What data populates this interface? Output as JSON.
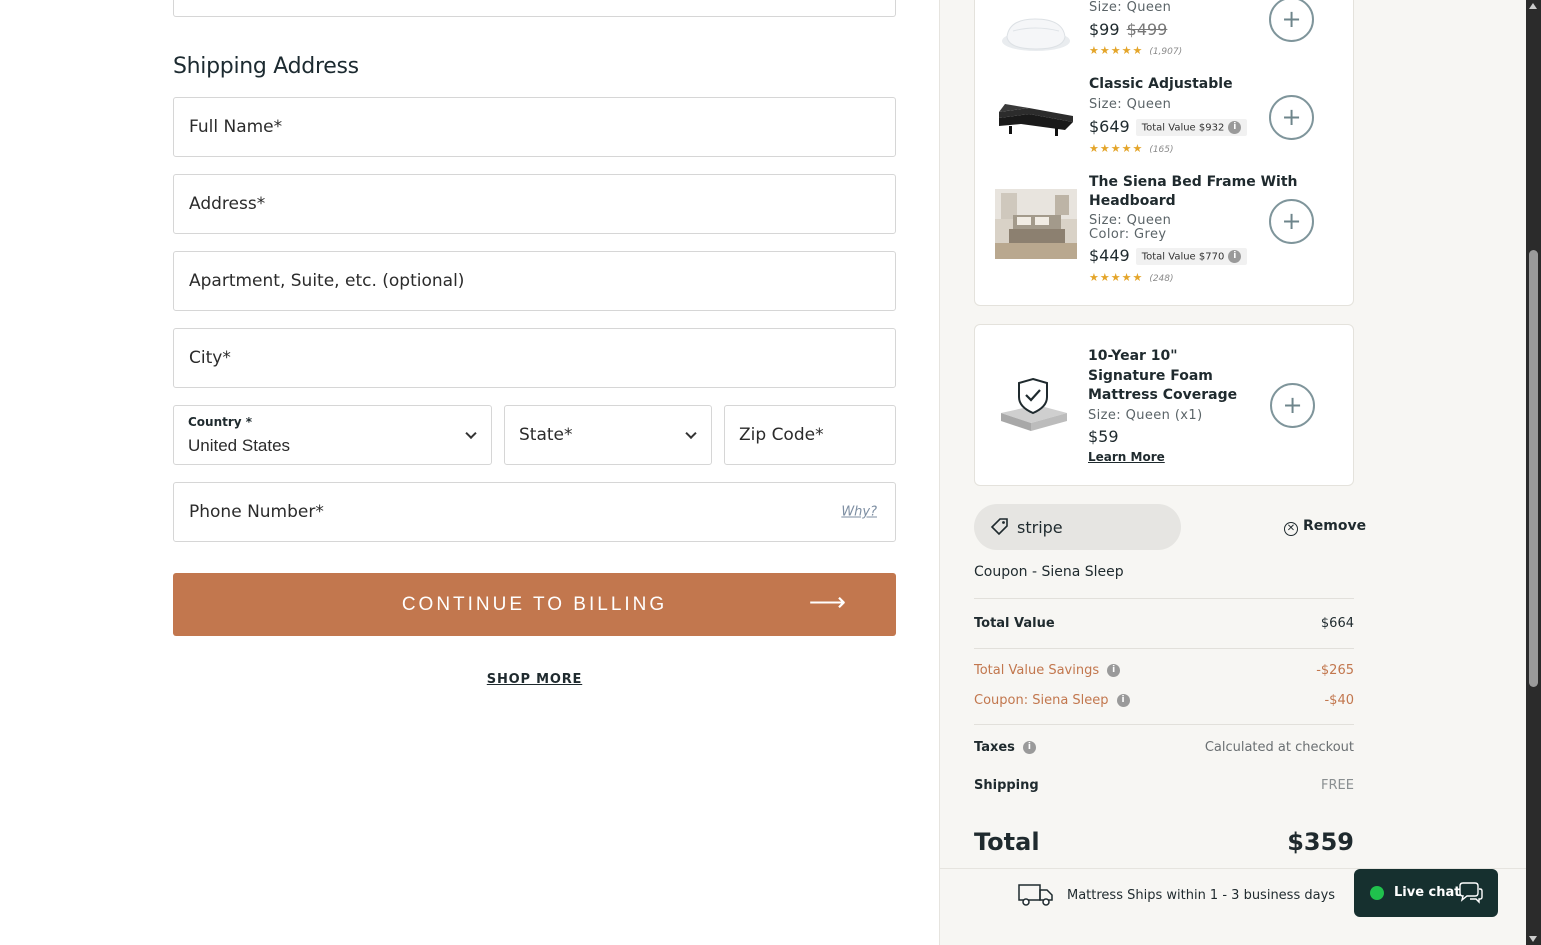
{
  "shipping": {
    "heading": "Shipping Address",
    "full_name_placeholder": "Full Name*",
    "address_placeholder": "Address*",
    "apartment_placeholder": "Apartment, Suite, etc. (optional)",
    "city_placeholder": "City*",
    "country_label": "Country *",
    "country_value": "United States",
    "state_placeholder": "State*",
    "zip_placeholder": "Zip Code*",
    "phone_placeholder": "Phone Number*",
    "phone_why": "Why?",
    "continue_label": "CONTINUE TO BILLING",
    "continue_arrow": "⟶",
    "shop_more": "SHOP MORE"
  },
  "upsells": [
    {
      "name": "",
      "meta": "Size: Queen",
      "price": "$99",
      "compare_price": "$499",
      "stars": "★★★★★",
      "reviews": "(1,907)",
      "icon": "pillow-image"
    },
    {
      "name": "Classic Adjustable",
      "meta": "Size: Queen",
      "price": "$649",
      "badge": "Total Value $932",
      "stars": "★★★★★",
      "reviews": "(165)",
      "icon": "adjustable-base-image"
    },
    {
      "name": "The Siena Bed Frame With Headboard",
      "meta": "Size: Queen",
      "meta2": "Color: Grey",
      "price": "$449",
      "badge": "Total Value $770",
      "stars": "★★★★★",
      "reviews": "(248)",
      "icon": "bed-frame-image"
    }
  ],
  "coverage": {
    "name": "10-Year 10\" Signature Foam Mattress Coverage",
    "meta": "Size: Queen (x1)",
    "price": "$59",
    "learn_more": "Learn More",
    "icon": "shield-check-icon"
  },
  "coupon": {
    "code": "stripe",
    "remove_label": "Remove",
    "note": "Coupon - Siena Sleep"
  },
  "summary": {
    "total_value_label": "Total Value",
    "total_value": "$664",
    "savings_label": "Total Value Savings",
    "savings": "-$265",
    "coupon_label": "Coupon: Siena Sleep",
    "coupon_amount": "-$40",
    "taxes_label": "Taxes",
    "taxes_value": "Calculated at checkout",
    "shipping_label": "Shipping",
    "shipping_value": "FREE",
    "total_label": "Total",
    "total": "$359",
    "ships_note": "Mattress Ships within 1 - 3 business days"
  },
  "livechat": {
    "label": "Live chat"
  },
  "colors": {
    "accent": "#c2774e",
    "livechat_bg": "#16302f",
    "online_dot": "#20c14d"
  }
}
